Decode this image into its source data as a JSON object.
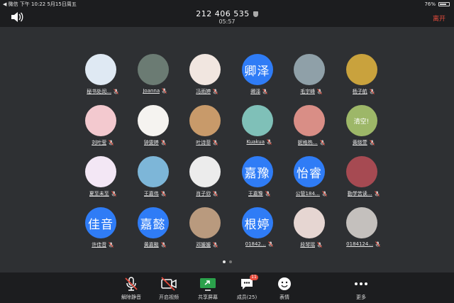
{
  "status": {
    "left": "◀ 微信  下午 10:22  5月15日周五",
    "battery": "76%",
    "battery_level": 0.76
  },
  "header": {
    "meeting_id": "212 406 535",
    "timer": "05:57",
    "leave": "离开"
  },
  "participants": [
    {
      "name": "秘书处闵…",
      "bg": "#dfe9f3",
      "glyph": ""
    },
    {
      "name": "Joanna",
      "bg": "#6b7b73",
      "glyph": ""
    },
    {
      "name": "冯雨婷",
      "bg": "#f1e6e0",
      "glyph": ""
    },
    {
      "name": "卿泽",
      "avatar_text": "卿泽"
    },
    {
      "name": "毛宇峰",
      "bg": "#8fa0a8",
      "glyph": ""
    },
    {
      "name": "杨子航",
      "bg": "#c9a23d",
      "glyph": ""
    },
    {
      "name": "刘叶莹",
      "bg": "#f3c9cf",
      "glyph": ""
    },
    {
      "name": "钟雯婷",
      "bg": "#f5f3f0",
      "glyph": ""
    },
    {
      "name": "叶诗菲",
      "bg": "#c89a6a",
      "glyph": ""
    },
    {
      "name": "Kuakua",
      "bg": "#7fc0b8",
      "glyph": ""
    },
    {
      "name": "妮格热…",
      "bg": "#d98e86",
      "glyph": ""
    },
    {
      "name": "黄晓萱",
      "bg": "#9db768",
      "glyph": "清空!"
    },
    {
      "name": "夏至未至",
      "bg": "#f3e7f5",
      "glyph": ""
    },
    {
      "name": "王嘉伟",
      "bg": "#7db6d8",
      "glyph": ""
    },
    {
      "name": "肖子欣",
      "bg": "#ececec",
      "glyph": ""
    },
    {
      "name": "王嘉豫",
      "avatar_text": "嘉豫"
    },
    {
      "name": "公管184…",
      "avatar_text": "怡睿"
    },
    {
      "name": "勤学苦读…",
      "bg": "#a64a52",
      "glyph": ""
    },
    {
      "name": "许佳音",
      "avatar_text": "佳音"
    },
    {
      "name": "黄嘉懿",
      "avatar_text": "嘉懿"
    },
    {
      "name": "邓媛媛",
      "bg": "#b99a7e",
      "glyph": ""
    },
    {
      "name": "01842…",
      "avatar_text": "根婷"
    },
    {
      "name": "段琴瑶",
      "bg": "#e6d6d2",
      "glyph": ""
    },
    {
      "name": "0184124…",
      "bg": "#c4c0bd",
      "glyph": ""
    }
  ],
  "pagination": {
    "current": 1,
    "total": 2
  },
  "toolbar": {
    "unmute": "解除静音",
    "video": "开启视频",
    "share": "共享屏幕",
    "members": "成员(25)",
    "members_badge": "11",
    "emoji": "表情",
    "more": "更多"
  }
}
